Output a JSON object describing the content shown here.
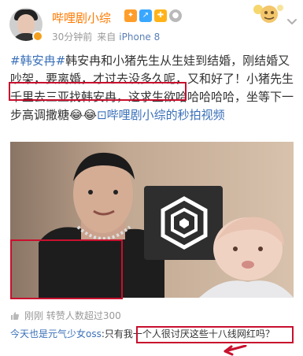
{
  "account": {
    "name": "哔哩剧小综",
    "time": "30分钟前",
    "source_prefix": "来自",
    "device": "iPhone 8"
  },
  "post": {
    "tag": "#韩安冉#",
    "text": "韩安冉和小猪先生从生娃到结婚，刚结婚又吵架，要离婚，才过去没多久呢，又和好了！小猪先生千里去三亚找韩安冉，这求生欲哈哈哈哈哈，坐等下一步高调撒糖😂😂",
    "link": "哔哩剧小综的秒拍视频"
  },
  "likes_text": "刚刚 转赞人数超过300",
  "comment": {
    "user": "今天也是元气少女oss",
    "text": "只有我一个人很讨厌这些十八线网红吗？"
  }
}
